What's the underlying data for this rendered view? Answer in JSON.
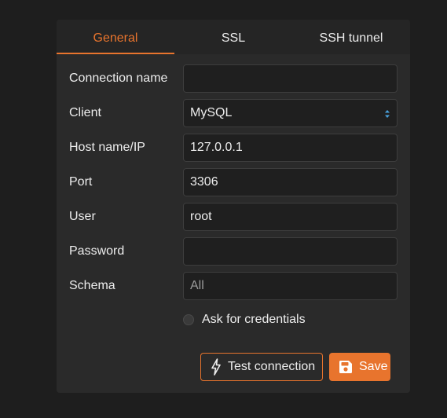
{
  "tabs": [
    {
      "label": "General",
      "active": true
    },
    {
      "label": "SSL",
      "active": false
    },
    {
      "label": "SSH tunnel",
      "active": false
    }
  ],
  "form": {
    "connection_name": {
      "label": "Connection name",
      "value": ""
    },
    "client": {
      "label": "Client",
      "value": "MySQL"
    },
    "host": {
      "label": "Host name/IP",
      "value": "127.0.0.1"
    },
    "port": {
      "label": "Port",
      "value": "3306"
    },
    "user": {
      "label": "User",
      "value": "root"
    },
    "password": {
      "label": "Password",
      "value": ""
    },
    "schema": {
      "label": "Schema",
      "value": "",
      "placeholder": "All"
    },
    "ask_credentials": {
      "label": "Ask for credentials",
      "checked": false
    }
  },
  "buttons": {
    "test_connection": "Test connection",
    "save": "Save"
  },
  "icons": {
    "test_connection": "lightning-bolt-icon",
    "save": "floppy-disk-icon",
    "client_select": "select-arrows-icon"
  },
  "colors": {
    "accent": "#e8742d",
    "panel": "#2a2a2a",
    "background": "#1e1e1e"
  }
}
